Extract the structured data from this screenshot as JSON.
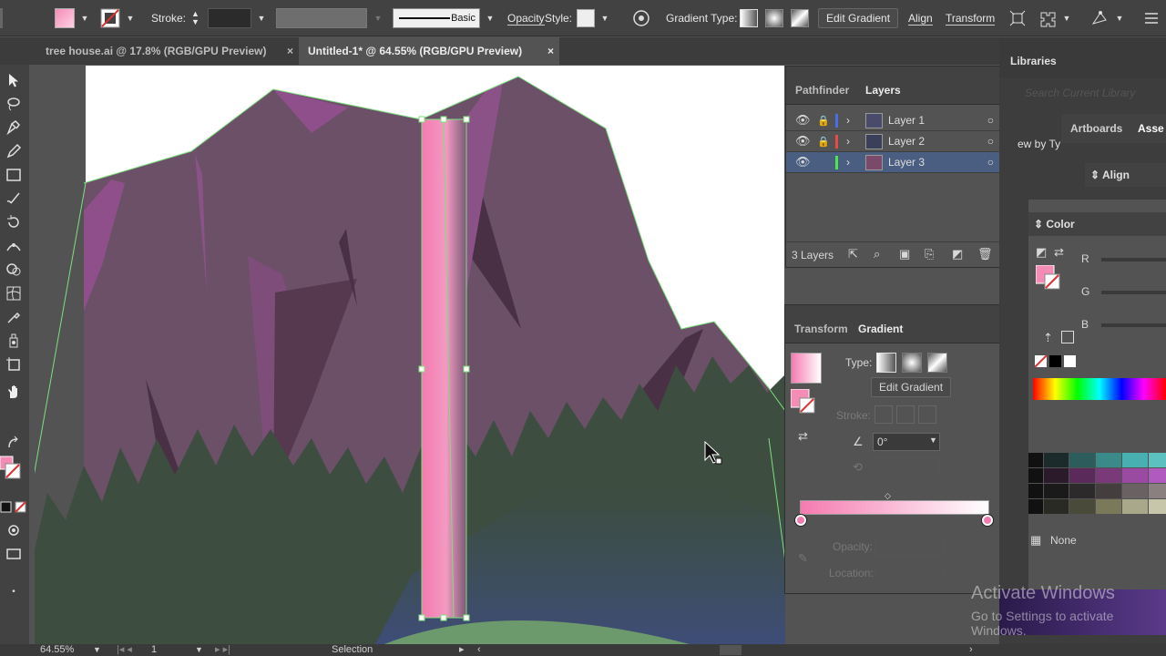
{
  "control_bar": {
    "stroke_label": "Stroke:",
    "brush_label": "Basic",
    "opacity_label": "Opacity",
    "style_label": "Style:",
    "gradient_type_label": "Gradient Type:",
    "edit_gradient_label": "Edit Gradient",
    "align_label": "Align",
    "transform_label": "Transform"
  },
  "tabs": [
    {
      "label": "tree house.ai @ 17.8% (RGB/GPU Preview)",
      "close": "×"
    },
    {
      "label": "Untitled-1* @ 64.55% (RGB/GPU Preview)",
      "close": "×"
    }
  ],
  "layers_panel": {
    "tabs": [
      "Pathfinder",
      "Layers"
    ],
    "layers": [
      {
        "name": "Layer 1",
        "color": "#4a6ee8"
      },
      {
        "name": "Layer 2",
        "color": "#e84a4a"
      },
      {
        "name": "Layer 3",
        "color": "#4ae84a"
      }
    ],
    "count_label": "3 Layers"
  },
  "gradient_panel": {
    "tabs": [
      "Transform",
      "Gradient"
    ],
    "type_label": "Type:",
    "edit_gradient_label": "Edit Gradient",
    "stroke_label": "Stroke:",
    "angle_value": "0°",
    "opacity_label": "Opacity:",
    "location_label": "Location:",
    "gradient_start_color": "#f57ab0",
    "gradient_end_color": "#ffffff"
  },
  "dock": {
    "libraries_label": "Libraries",
    "search_placeholder": "Search Current Library",
    "artboards_label": "Artboards",
    "assets_label": "Asse",
    "view_by_label": "ew by Ty",
    "align_label": "Align",
    "color_label": "Color",
    "r_label": "R",
    "g_label": "G",
    "b_label": "B",
    "none_label": "None"
  },
  "watermark": {
    "title": "Activate Windows",
    "subtitle": "Go to Settings to activate Windows."
  },
  "status_bar": {
    "zoom": "64.55%",
    "artboard_num": "1",
    "tool": "Selection"
  },
  "colors": {
    "fill": "#f48cb6",
    "selection": "#7ee07e",
    "mountain": "#6b5068",
    "forest": "#3d4d3f",
    "accent_blue": "#4a5e82"
  }
}
